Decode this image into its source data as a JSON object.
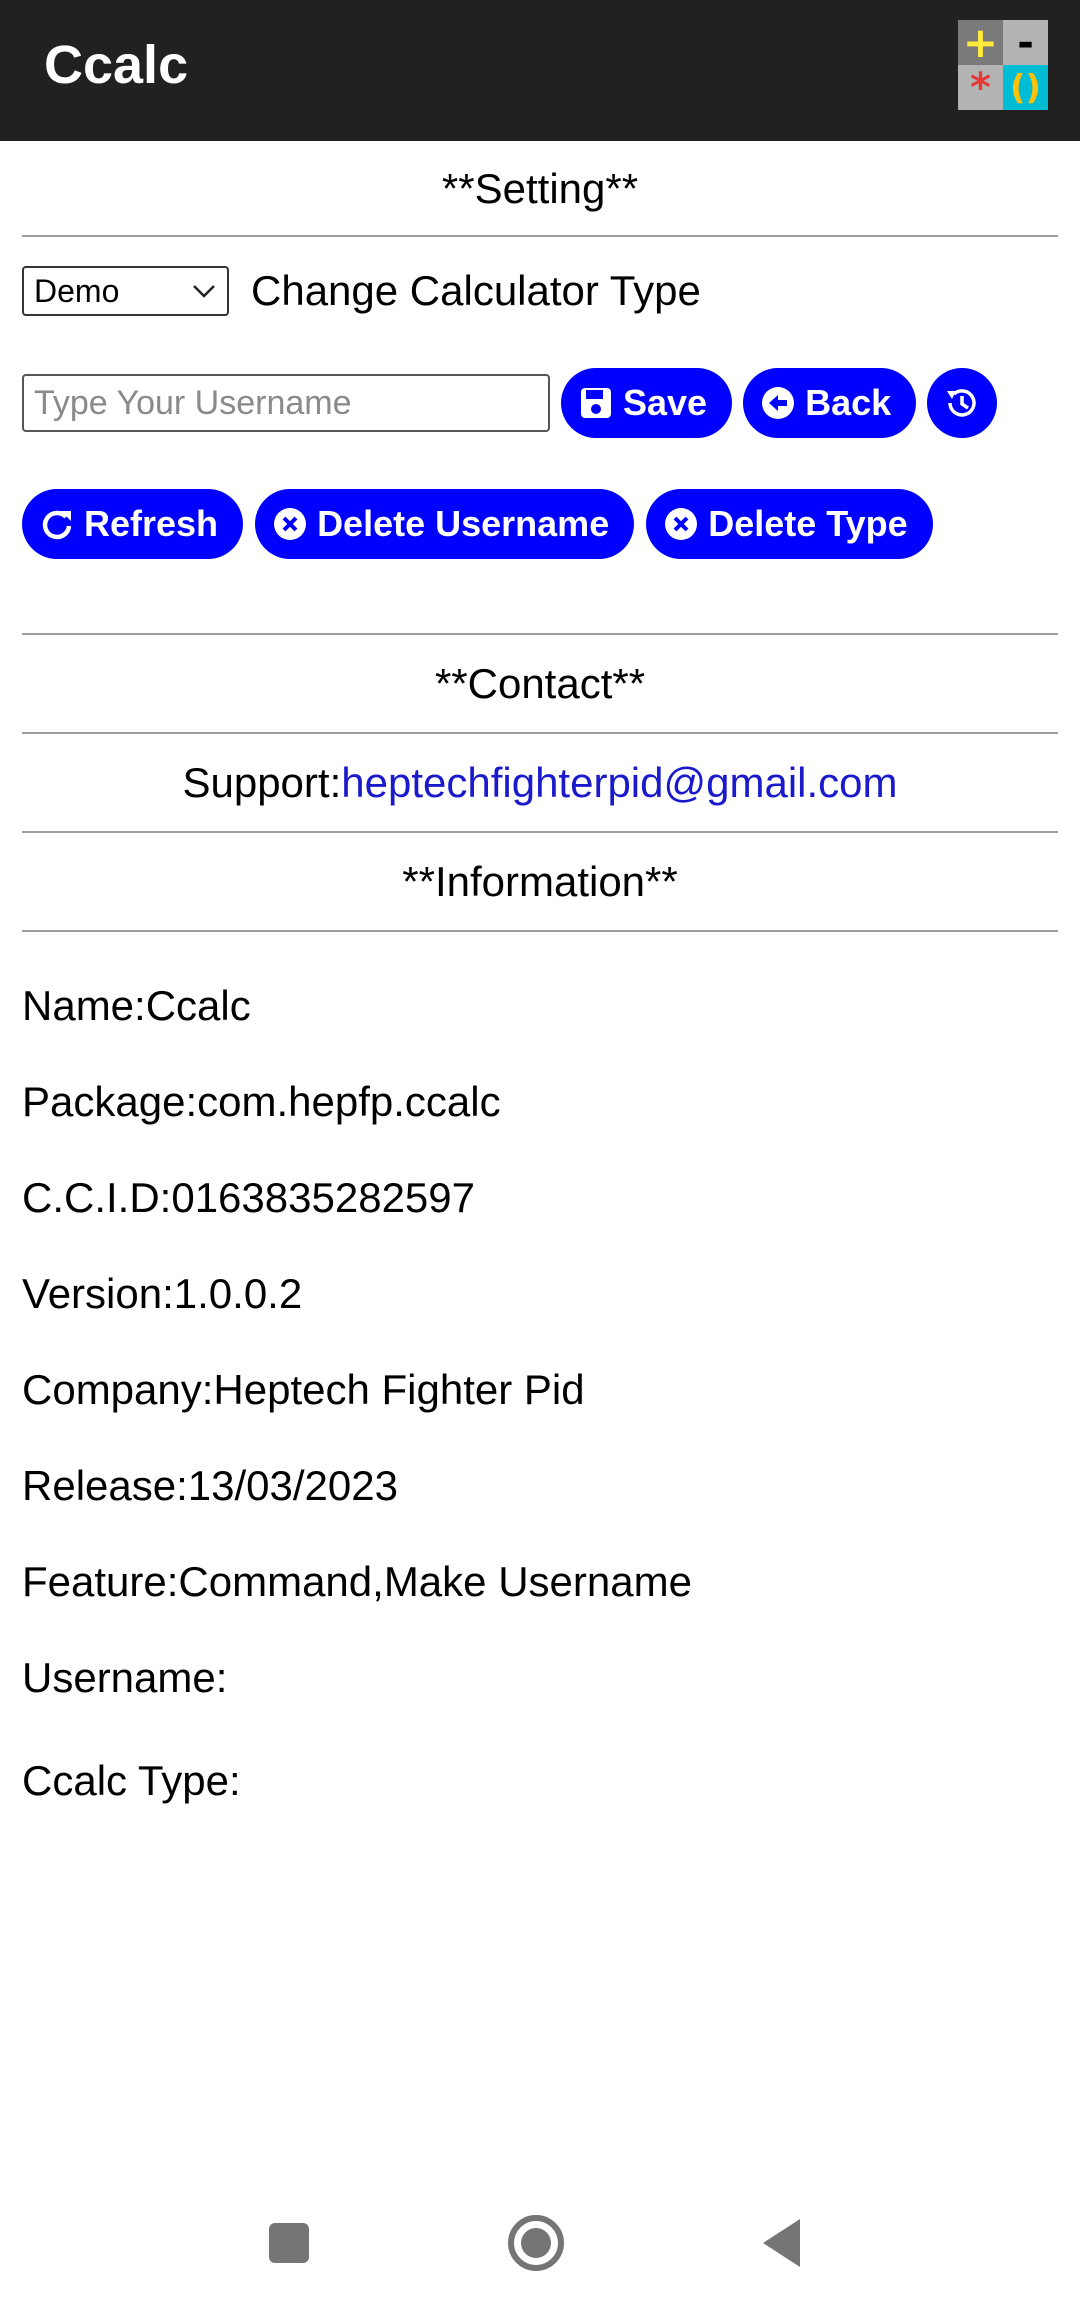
{
  "app": {
    "title": "Ccalc",
    "logo_glyphs": [
      "+",
      "-",
      "*",
      "()"
    ],
    "logo_icon": "calculator-logo-icon"
  },
  "setting": {
    "heading": "**Setting**",
    "calculator_type": {
      "selected": "Demo",
      "label": "Change Calculator Type"
    },
    "username_input": {
      "value": "",
      "placeholder": "Type Your Username"
    },
    "buttons": {
      "save": "Save",
      "back": "Back",
      "history_icon": "history-icon",
      "refresh": "Refresh",
      "delete_username": "Delete Username",
      "delete_type": "Delete Type"
    },
    "accent_color": "#0000ff"
  },
  "contact": {
    "heading": "**Contact**",
    "support_label": "Support:",
    "support_email": "heptechfighterpid@gmail.com"
  },
  "information": {
    "heading": "**Information**",
    "items": [
      "Name:Ccalc",
      "Package:com.hepfp.ccalc",
      "C.C.I.D:0163835282597",
      "Version:1.0.0.2",
      "Company:Heptech Fighter Pid",
      "Release:13/03/2023",
      "Feature:Command,Make Username",
      "Username:",
      "Ccalc Type:"
    ]
  },
  "navbar": {
    "icons": [
      "recents-square-icon",
      "home-circle-icon",
      "back-triangle-icon"
    ]
  }
}
